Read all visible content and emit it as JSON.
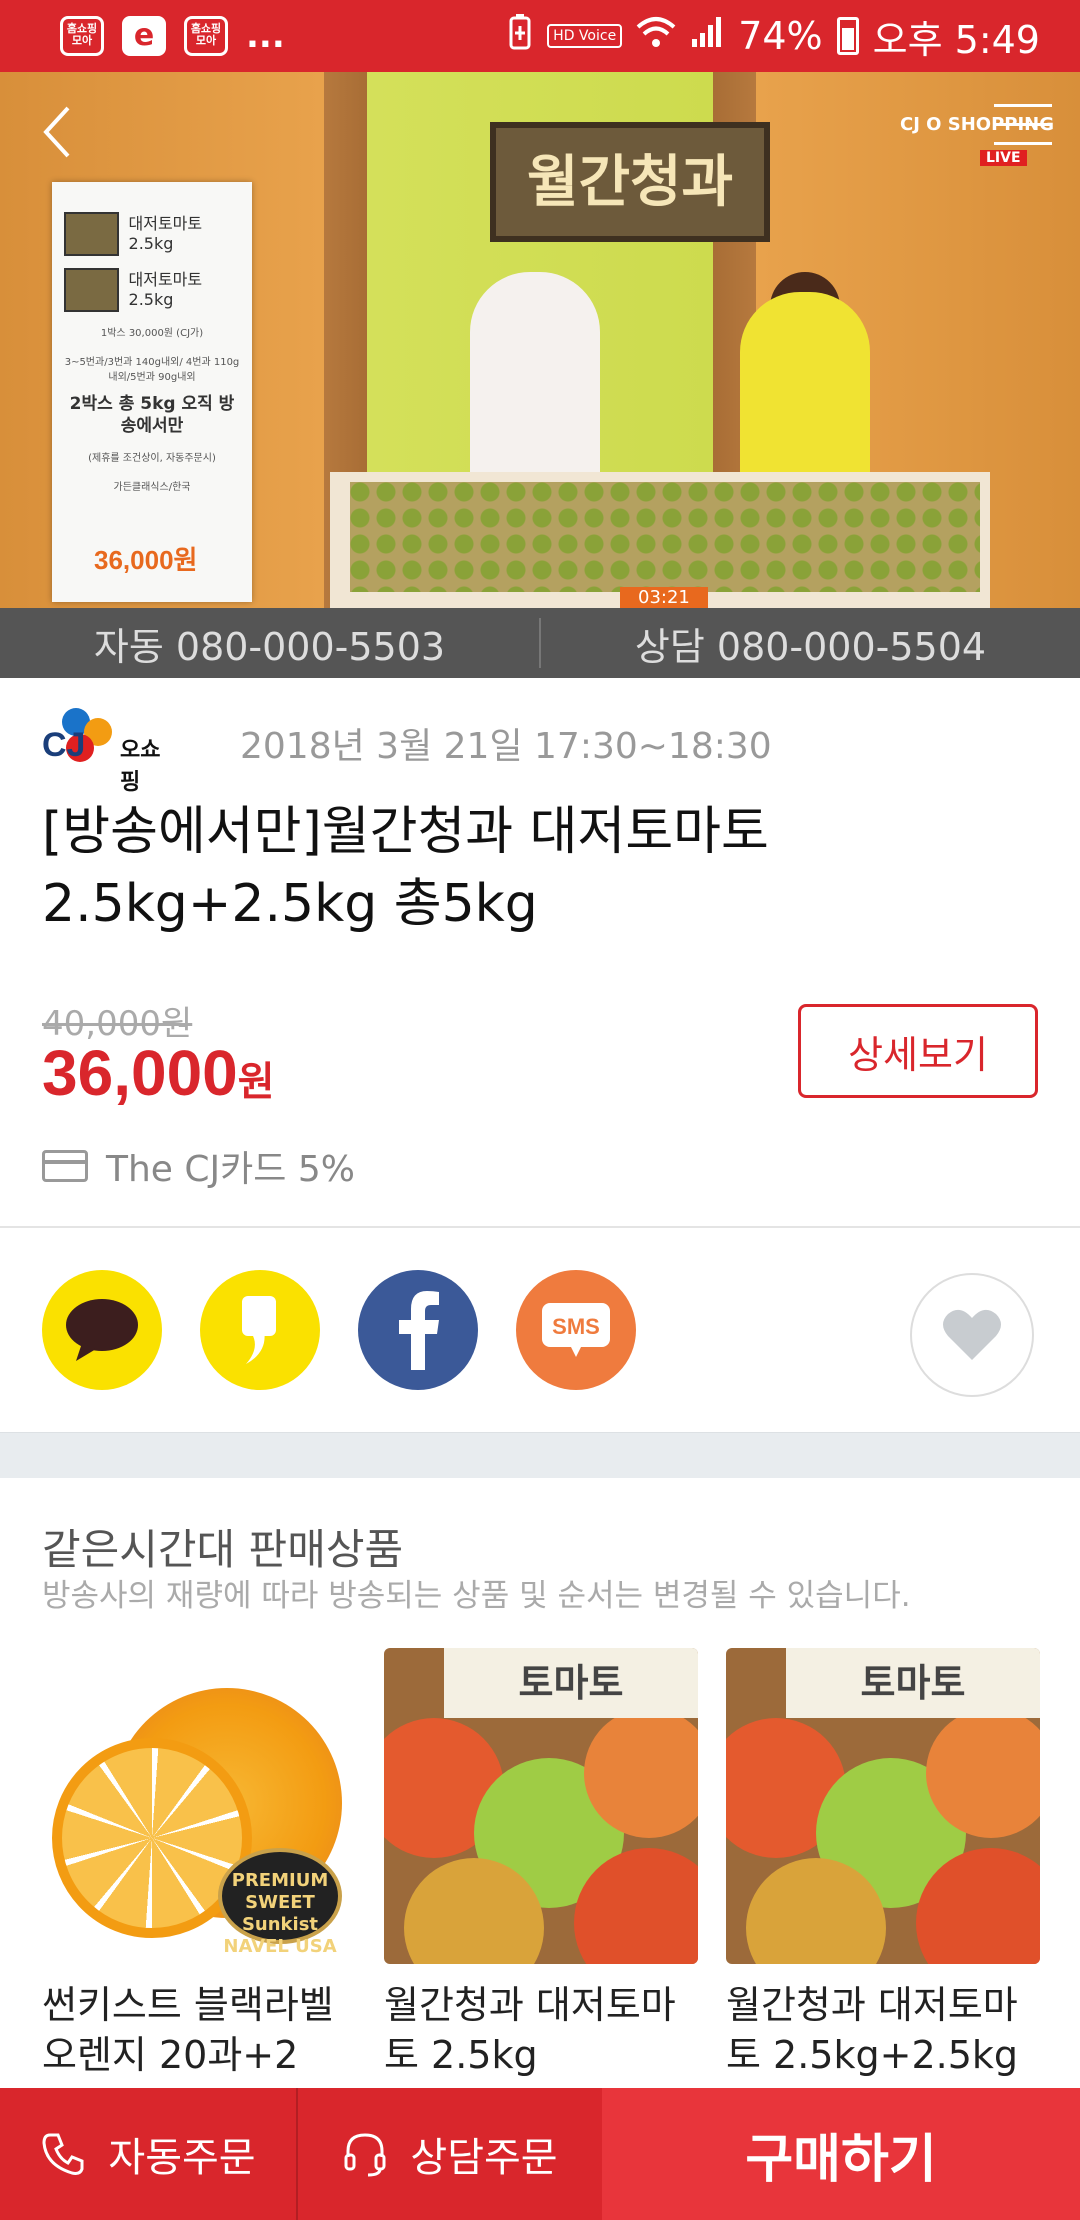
{
  "statusbar": {
    "apps": [
      "홈쇼핑모아",
      "e",
      "홈쇼핑모아"
    ],
    "more": "...",
    "hd": "HD Voice",
    "battery": "74%",
    "time": "오후 5:49"
  },
  "video": {
    "sign": "월간청과",
    "card_items": [
      {
        "label": "대저토마토 2.5kg"
      },
      {
        "label": "대저토마토 2.5kg"
      }
    ],
    "card_note1": "1박스 30,000원 (CJ가)",
    "card_note2": "3~5번과/3번과 140g내외/ 4번과 110g내외/5번과 90g내외",
    "card_big": "2박스 총 5kg 오직 방송에서만",
    "card_price": "36,000원",
    "card_note3": "(제휴를 조건상이, 자동주문시)",
    "card_note4": "가든클래식스/한국",
    "logo": "CJ O SHOPPING",
    "live": "LIVE",
    "timer": "03:21"
  },
  "phonebar": {
    "auto": "자동 080-000-5503",
    "consult": "상담 080-000-5504"
  },
  "product": {
    "brand": "오쇼핑",
    "brand_cj": "CJ",
    "date": "2018년 3월 21일 17:30~18:30",
    "title": "[방송에서만]월간청과 대저토마토 2.5kg+2.5kg 총5kg",
    "original_price": "40,000원",
    "price_value": "36,000",
    "price_unit": "원",
    "detail_button": "상세보기",
    "card_benefit": "The CJ카드 5%"
  },
  "share": {
    "kakaotalk_icon": "kakaotalk-icon",
    "kakaostory_icon": "kakaostory-icon",
    "facebook_icon": "facebook-icon",
    "sms_label": "SMS",
    "colors": {
      "kakao": "#fae100",
      "facebook": "#3b5998",
      "sms": "#ef7b3e"
    }
  },
  "same_time": {
    "title": "같은시간대 판매상품",
    "subtitle": "방송사의 재량에 따라 방송되는 상품 및 순서는 변경될 수 있습니다.",
    "products": [
      {
        "name": "썬키스트 블랙라벨 오렌지 20과+2",
        "badge": "PREMIUM SWEET Sunkist NAVEL USA"
      },
      {
        "name": "월간청과 대저토마토 2.5kg",
        "sign": "토마토"
      },
      {
        "name": "월간청과 대저토마토 2.5kg+2.5kg",
        "sign": "토마토"
      }
    ]
  },
  "bottombar": {
    "auto_order": "자동주문",
    "consult_order": "상담주문",
    "buy": "구매하기"
  },
  "colors": {
    "accent": "#d9262c",
    "buy": "#e8353b"
  }
}
